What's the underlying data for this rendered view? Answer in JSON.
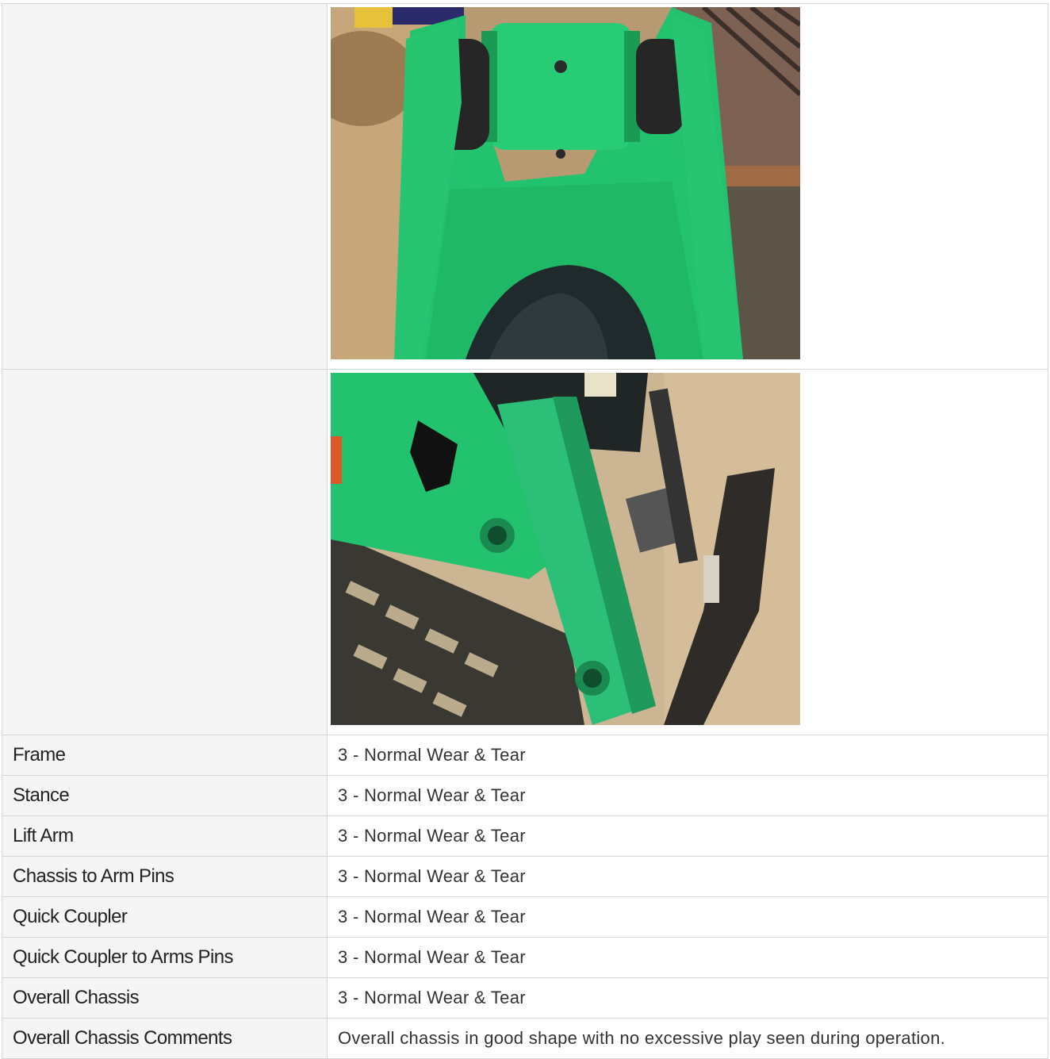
{
  "photos": [
    {
      "name": "lift-arm-quick-coupler-photo",
      "accent": "#22c26e"
    },
    {
      "name": "lift-arm-side-tracks-photo",
      "accent": "#22c26e"
    }
  ],
  "rows": [
    {
      "label": "Frame",
      "value": "3 - Normal Wear & Tear"
    },
    {
      "label": "Stance",
      "value": "3 - Normal Wear & Tear"
    },
    {
      "label": "Lift Arm",
      "value": "3 - Normal Wear & Tear"
    },
    {
      "label": "Chassis to Arm Pins",
      "value": "3 - Normal Wear & Tear"
    },
    {
      "label": "Quick Coupler",
      "value": "3 - Normal Wear & Tear"
    },
    {
      "label": "Quick Coupler to Arms Pins",
      "value": "3 - Normal Wear & Tear"
    },
    {
      "label": "Overall Chassis",
      "value": "3 - Normal Wear & Tear"
    },
    {
      "label": "Overall Chassis Comments",
      "value": "Overall chassis in good shape with no excessive play seen during operation."
    }
  ],
  "colors": {
    "border": "#d6d6d6",
    "label_bg": "#f5f5f5",
    "machine_green": "#22c26e"
  }
}
